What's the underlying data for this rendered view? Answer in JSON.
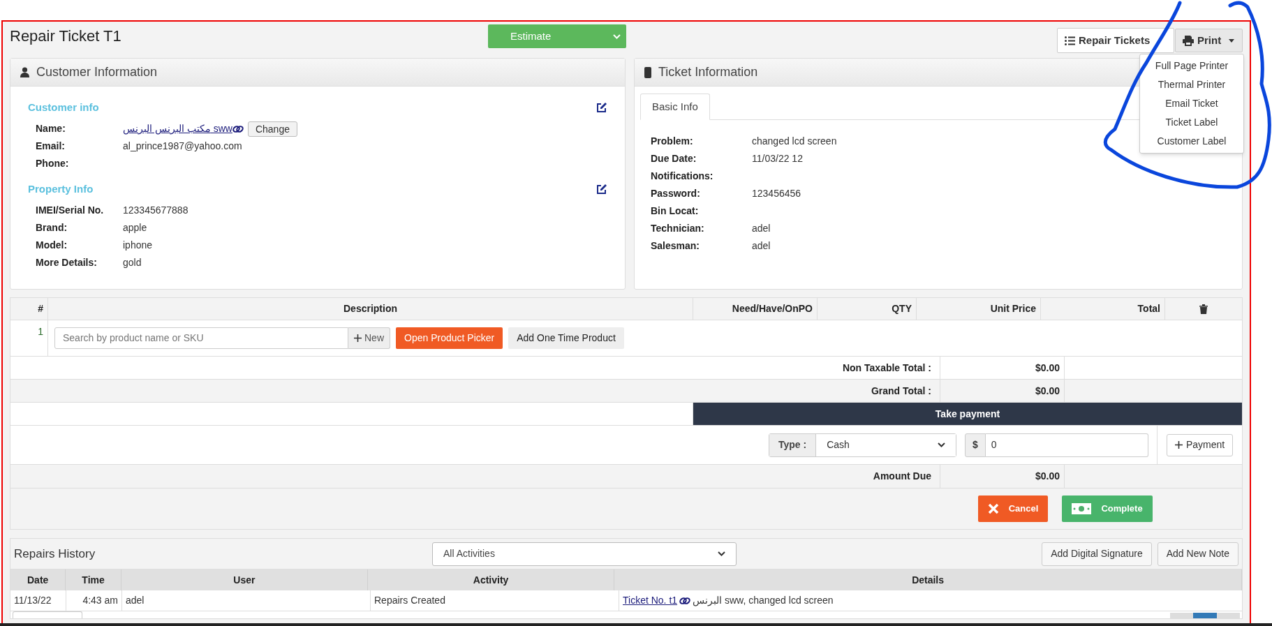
{
  "page": {
    "title": "Repair Ticket T1",
    "status": "Estimate"
  },
  "toolbar": {
    "buttons": [
      {
        "label": "Repair Tickets",
        "kind": "list"
      },
      {
        "label": "Print",
        "kind": "print"
      }
    ]
  },
  "print_menu": {
    "items": [
      "Full Page Printer",
      "Thermal Printer",
      "Email Ticket",
      "Ticket Label",
      "Customer Label"
    ]
  },
  "customer_panel": {
    "title": "Customer Information",
    "sections": [
      {
        "heading": "Customer info",
        "fields": [
          {
            "label": "Name:",
            "value": "مكتب البرنس البرنس sww",
            "kind": "link",
            "action": "Change"
          },
          {
            "label": "Email:",
            "value": "al_prince1987@yahoo.com",
            "kind": "text"
          },
          {
            "label": "Phone:",
            "kind": "text"
          }
        ]
      },
      {
        "heading": "Property Info",
        "fields": [
          {
            "label": "IMEI/Serial No.",
            "value": "123345677888",
            "kind": "text"
          },
          {
            "label": "Brand:",
            "value": "apple",
            "kind": "text"
          },
          {
            "label": "Model:",
            "value": "iphone",
            "kind": "text"
          },
          {
            "label": "More Details:",
            "value": "gold",
            "kind": "text"
          }
        ]
      }
    ]
  },
  "ticket_panel": {
    "title": "Ticket Information",
    "tabs": [
      {
        "label": "Basic Info",
        "selected": true
      }
    ],
    "fields": [
      {
        "label": "Problem:",
        "value": "changed lcd screen"
      },
      {
        "label": "Due Date:",
        "value": "11/03/22 12"
      },
      {
        "label": "Notifications:"
      },
      {
        "label": "Password:",
        "value": "123456456"
      },
      {
        "label": "Bin Locat:"
      },
      {
        "label": "Technician:",
        "value": "adel"
      },
      {
        "label": "Salesman:",
        "value": "adel"
      }
    ]
  },
  "items_table": {
    "columns": [
      "#",
      "Description",
      "Need/Have/OnPO",
      "QTY",
      "Unit Price",
      "Total"
    ],
    "rows": [
      {
        "number": "1",
        "search_placeholder": "Search by product name or SKU",
        "new_button": "New",
        "picker_button": "Open Product Picker",
        "one_time_button": "Add One Time Product"
      }
    ]
  },
  "totals": [
    {
      "label": "Non Taxable Total :",
      "value": "$0.00"
    },
    {
      "label": "Grand Total :",
      "value": "$0.00"
    }
  ],
  "payment": {
    "title": "Take payment",
    "type_label": "Type :",
    "type_value": "Cash",
    "currency": "$",
    "amount": "0",
    "add_button": "Payment",
    "amount_due_label": "Amount Due",
    "amount_due": "$0.00",
    "cancel_button": "Cancel",
    "complete_button": "Complete"
  },
  "history": {
    "title": "Repairs History",
    "filter": "All Activities",
    "buttons": [
      "Add Digital Signature",
      "Add New Note"
    ],
    "columns": [
      "Date",
      "Time",
      "User",
      "Activity",
      "Details"
    ],
    "rows": [
      {
        "date": "11/13/22",
        "time": "4:43 am",
        "user": "adel",
        "activity": "Repairs Created",
        "details_link": "Ticket No. t1",
        "details_text": "البرنس sww, changed lcd screen"
      }
    ]
  }
}
